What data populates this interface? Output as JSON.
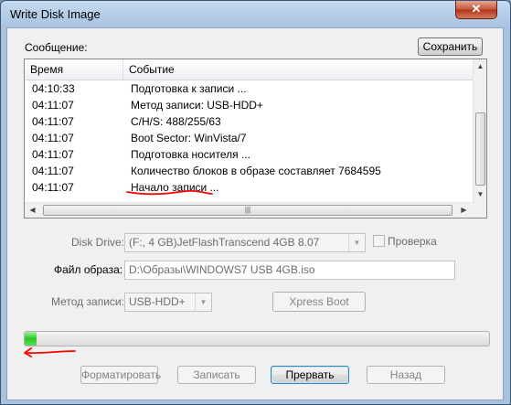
{
  "window": {
    "title": "Write Disk Image",
    "close_glyph": "✕"
  },
  "log": {
    "label": "Сообщение:",
    "save_button": "Сохранить",
    "columns": [
      "Время",
      "Событие"
    ],
    "rows": [
      {
        "time": "04:10:33",
        "event": "Подготовка к записи ..."
      },
      {
        "time": "04:11:07",
        "event": "Метод записи: USB-HDD+"
      },
      {
        "time": "04:11:07",
        "event": "C/H/S: 488/255/63"
      },
      {
        "time": "04:11:07",
        "event": "Boot Sector: WinVista/7"
      },
      {
        "time": "04:11:07",
        "event": "Подготовка носителя ..."
      },
      {
        "time": "04:11:07",
        "event": "Количество блоков в образе составляет 7684595"
      },
      {
        "time": "04:11:07",
        "event": "Начало записи ..."
      }
    ]
  },
  "form": {
    "disk_drive_label": "Disk Drive:",
    "disk_drive_value": "(F:, 4 GB)JetFlashTranscend 4GB   8.07",
    "verify_label": "Проверка",
    "image_file_label": "Файл образа:",
    "image_file_value": "D:\\Образы\\WINDOWS7 USB 4GB.iso",
    "write_method_label": "Метод записи:",
    "write_method_value": "USB-HDD+",
    "xpress_boot_button": "Xpress Boot"
  },
  "progress": {
    "fraction": 0.025,
    "fill_color": "#22c922"
  },
  "buttons": {
    "format": "Форматировать",
    "write": "Записать",
    "abort": "Прервать",
    "back": "Назад"
  },
  "annotation_color": "#ff0000"
}
